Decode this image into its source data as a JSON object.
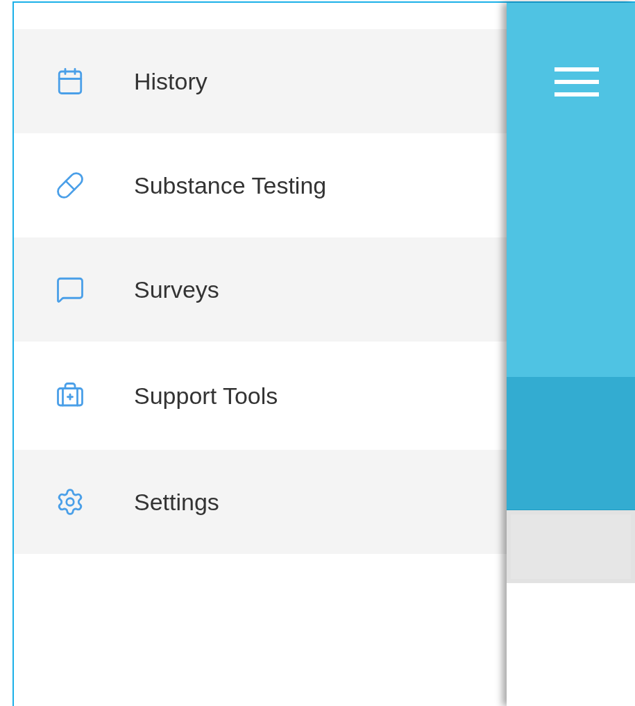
{
  "menu": {
    "items": [
      {
        "label": "History"
      },
      {
        "label": "Substance Testing"
      },
      {
        "label": "Surveys"
      },
      {
        "label": "Support Tools"
      },
      {
        "label": "Settings"
      }
    ]
  }
}
